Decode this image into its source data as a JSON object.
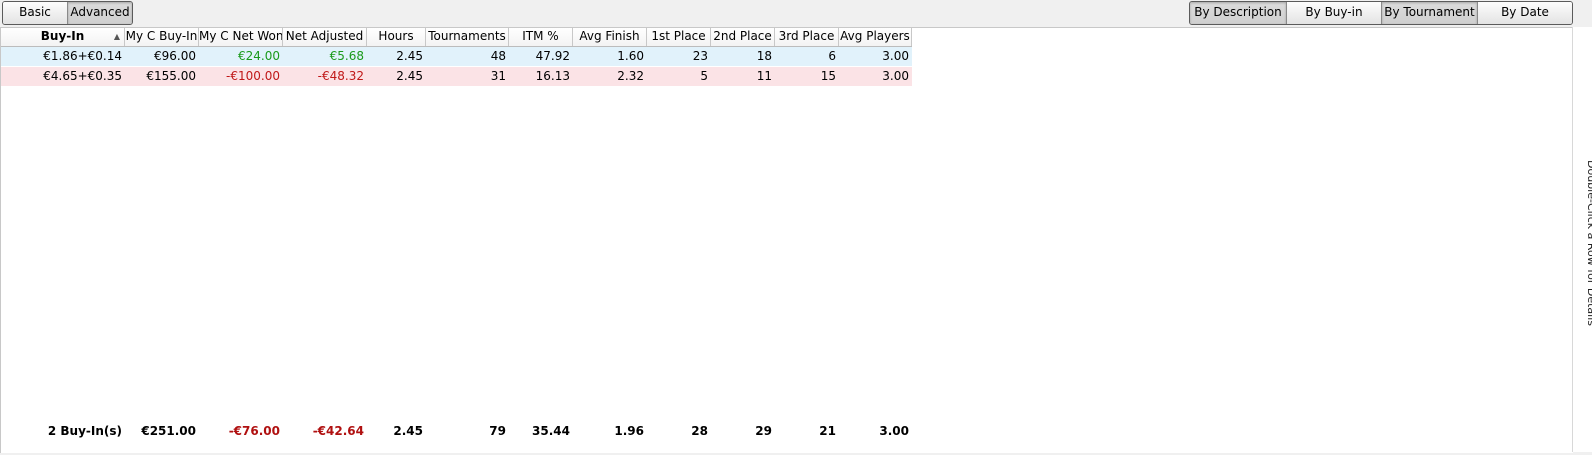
{
  "toolbar": {
    "left_buttons": [
      {
        "label": "Basic",
        "active": false
      },
      {
        "label": "Advanced",
        "active": true
      }
    ],
    "right_buttons": [
      {
        "label": "By Description",
        "active": true
      },
      {
        "label": "By Buy-in",
        "active": false
      },
      {
        "label": "By Tournament",
        "active": true
      },
      {
        "label": "By Date",
        "active": false
      }
    ]
  },
  "table": {
    "columns": [
      "Buy-In",
      "My C Buy-In",
      "My C Net Won",
      "Net Adjusted",
      "Hours",
      "Tournaments",
      "ITM %",
      "Avg Finish",
      "1st Place",
      "2nd Place",
      "3rd Place",
      "Avg Players"
    ],
    "sorted_column": "Buy-In",
    "rows": [
      [
        "€1.86+€0.14",
        "€96.00",
        "€24.00",
        "€5.68",
        "2.45",
        "48",
        "47.92",
        "1.60",
        "23",
        "18",
        "6",
        "3.00"
      ],
      [
        "€4.65+€0.35",
        "€155.00",
        "-€100.00",
        "-€48.32",
        "2.45",
        "31",
        "16.13",
        "2.32",
        "5",
        "11",
        "15",
        "3.00"
      ]
    ],
    "totals": [
      "2 Buy-In(s)",
      "€251.00",
      "-€76.00",
      "-€42.64",
      "2.45",
      "79",
      "35.44",
      "1.96",
      "28",
      "29",
      "21",
      "3.00"
    ]
  },
  "side_hint": "Double-Click a Row for Details",
  "colors": {
    "positive": "#1a9a1a",
    "negative": "#c01818",
    "row_blue": "#e1f2fb",
    "row_pink": "#fbe3e6"
  }
}
